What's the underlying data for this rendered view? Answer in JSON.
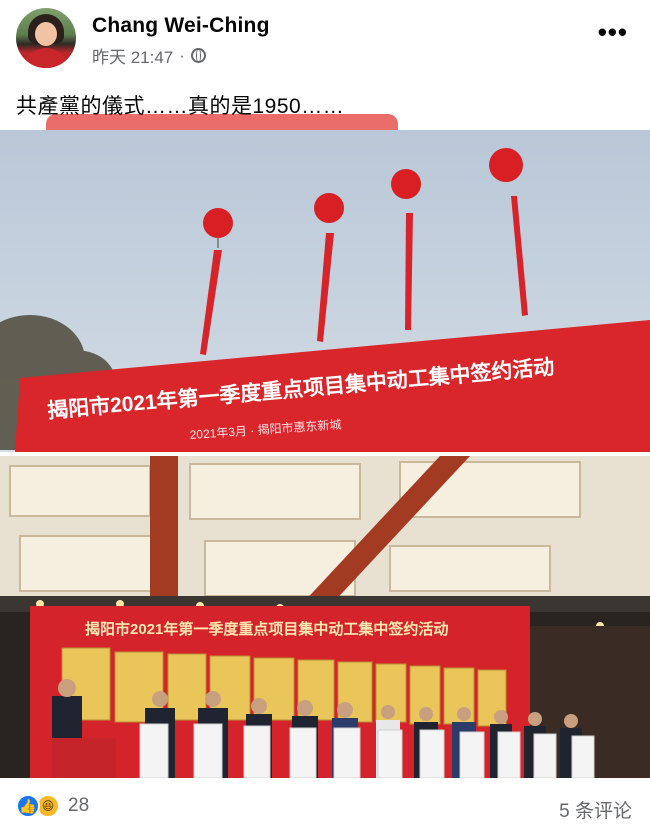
{
  "post": {
    "author": "Chang Wei-Ching",
    "time": "昨天 21:47",
    "separator": "·",
    "text": "共產黨的儀式……真的是1950……",
    "more_icon": "more-options-icon"
  },
  "images": {
    "banner_outdoor": {
      "title": "揭阳市2021年第一季度重点项目集中动工集中签约活动",
      "subtitle": "2021年3月 · 揭阳市惠东新城"
    },
    "banner_indoor": {
      "title": "揭阳市2021年第一季度重点项目集中动工集中签约活动"
    }
  },
  "footer": {
    "reaction_count": "28",
    "comments": "5 条评论",
    "reaction_icons": [
      "like-icon",
      "haha-icon"
    ]
  },
  "colors": {
    "brand_blue": "#1877f2",
    "banner_red": "#d8262b",
    "highlight_red": "#e8534f"
  }
}
